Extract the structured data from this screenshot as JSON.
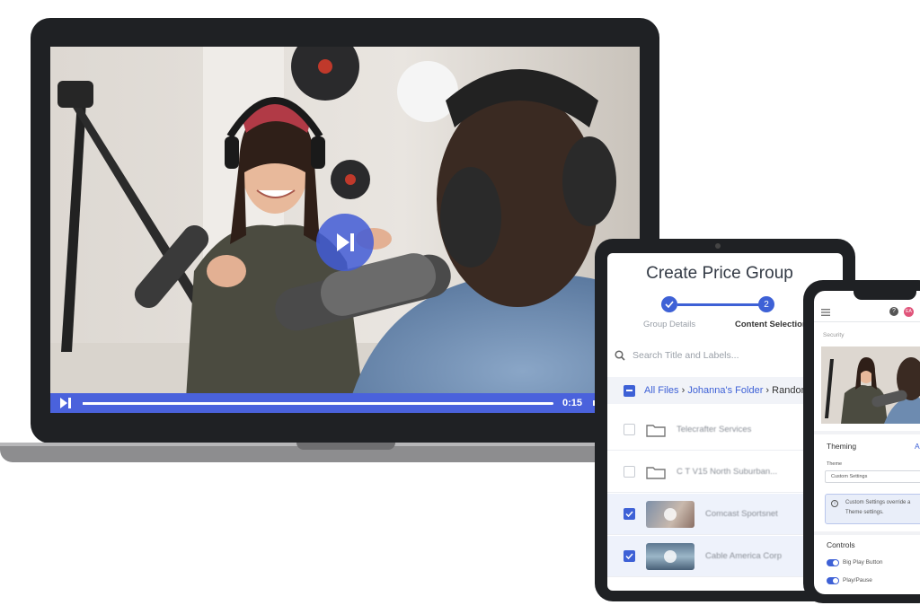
{
  "laptop": {
    "player": {
      "time": "0:15",
      "progress": 0.98
    }
  },
  "tablet": {
    "title": "Create Price Group",
    "steps": [
      {
        "number": "",
        "label": "Group Details",
        "state": "complete"
      },
      {
        "number": "2",
        "label": "Content Selection",
        "state": "active"
      }
    ],
    "search": {
      "placeholder": "Search Title and Labels..."
    },
    "breadcrumb": {
      "root": "All Files",
      "sep": "›",
      "folder": "Johanna's Folder",
      "current": "Random"
    },
    "rows": [
      {
        "type": "folder",
        "name": "Telecrafter Services",
        "checked": false
      },
      {
        "type": "folder",
        "name": "C T V15 North Suburban...",
        "checked": false
      },
      {
        "type": "video",
        "name": "Comcast Sportsnet",
        "checked": true
      },
      {
        "type": "video",
        "name": "Cable America Corp",
        "checked": true
      }
    ]
  },
  "phone": {
    "nav_label": "Security",
    "badge": "EA",
    "theming": {
      "title": "Theming",
      "action": "A",
      "theme_label": "Theme",
      "theme_value": "Custom Settings",
      "info_line1": "Custom Settings override a",
      "info_line2": "Theme settings."
    },
    "controls": {
      "title": "Controls",
      "items": [
        "Big Play Button",
        "Play/Pause"
      ]
    }
  },
  "colors": {
    "accent": "#3e61d6",
    "player_bar": "#4a62dc",
    "device_frame": "#1f2124"
  }
}
